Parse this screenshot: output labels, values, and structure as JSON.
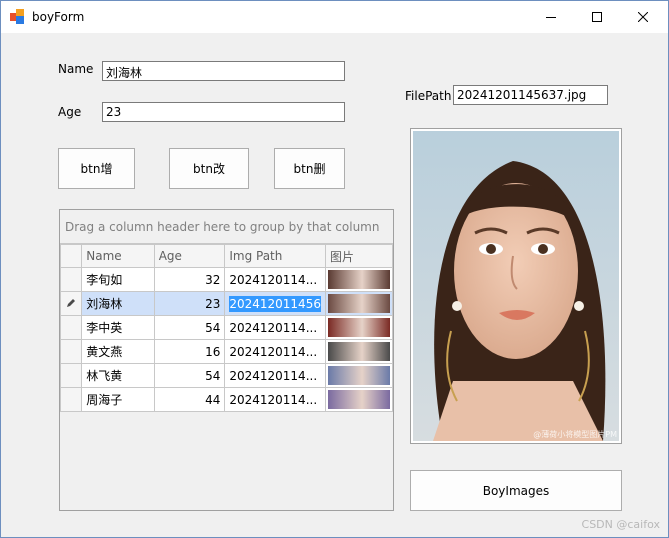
{
  "window": {
    "title": "boyForm",
    "icon": "app-grid-icon",
    "controls": [
      "minimize-icon",
      "maximize-icon",
      "close-icon"
    ]
  },
  "form": {
    "name_label": "Name",
    "name_value": "刘海林",
    "age_label": "Age",
    "age_value": "23",
    "filepath_label": "FilePath",
    "filepath_value": "20241201145637.jpg"
  },
  "buttons": {
    "add": "btn增",
    "edit": "btn改",
    "delete": "btn删",
    "boy_images": "BoyImages"
  },
  "grid": {
    "group_hint": "Drag a column header here to group by that column",
    "columns": [
      "Name",
      "Age",
      "Img Path",
      "图片"
    ],
    "rows": [
      {
        "name": "李旬如",
        "age": "32",
        "img_path": "2024120114...",
        "thumb_color": "#5a3a32"
      },
      {
        "name": "刘海林",
        "age": "23",
        "img_path": "202412011456",
        "thumb_color": "#6b4a42"
      },
      {
        "name": "李中英",
        "age": "54",
        "img_path": "2024120114...",
        "thumb_color": "#7a2a24"
      },
      {
        "name": "黄文燕",
        "age": "16",
        "img_path": "2024120114...",
        "thumb_color": "#4a4a4a"
      },
      {
        "name": "林飞黄",
        "age": "54",
        "img_path": "2024120114...",
        "thumb_color": "#6a7aa8"
      },
      {
        "name": "周海子",
        "age": "44",
        "img_path": "2024120114...",
        "thumb_color": "#7a6aa0"
      }
    ],
    "selected_index": 1,
    "edit_indicator": "pencil-icon"
  },
  "photo": {
    "caption": "@薄荷小将模型图片PM"
  },
  "watermark": "CSDN @caifox"
}
